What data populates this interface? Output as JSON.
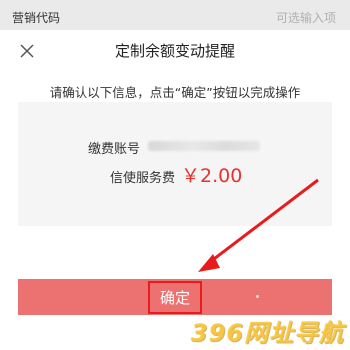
{
  "background": {
    "row_label": "营销代码",
    "row_placeholder": "可选输入项"
  },
  "dialog": {
    "title": "定制余额变动提醒",
    "instruction": "请确认以下信息，点击“确定”按钮以完成操作",
    "account_label": "缴费账号",
    "fee_label": "信使服务费",
    "fee_value": "￥2.00",
    "confirm_label": "确定"
  },
  "icons": {
    "close": "close-icon",
    "arrow": "red-arrow-annotation"
  },
  "colors": {
    "button": "#ec7272",
    "fee": "#e8322e",
    "annotation": "#e81c1c"
  },
  "watermark": "396网址导航"
}
